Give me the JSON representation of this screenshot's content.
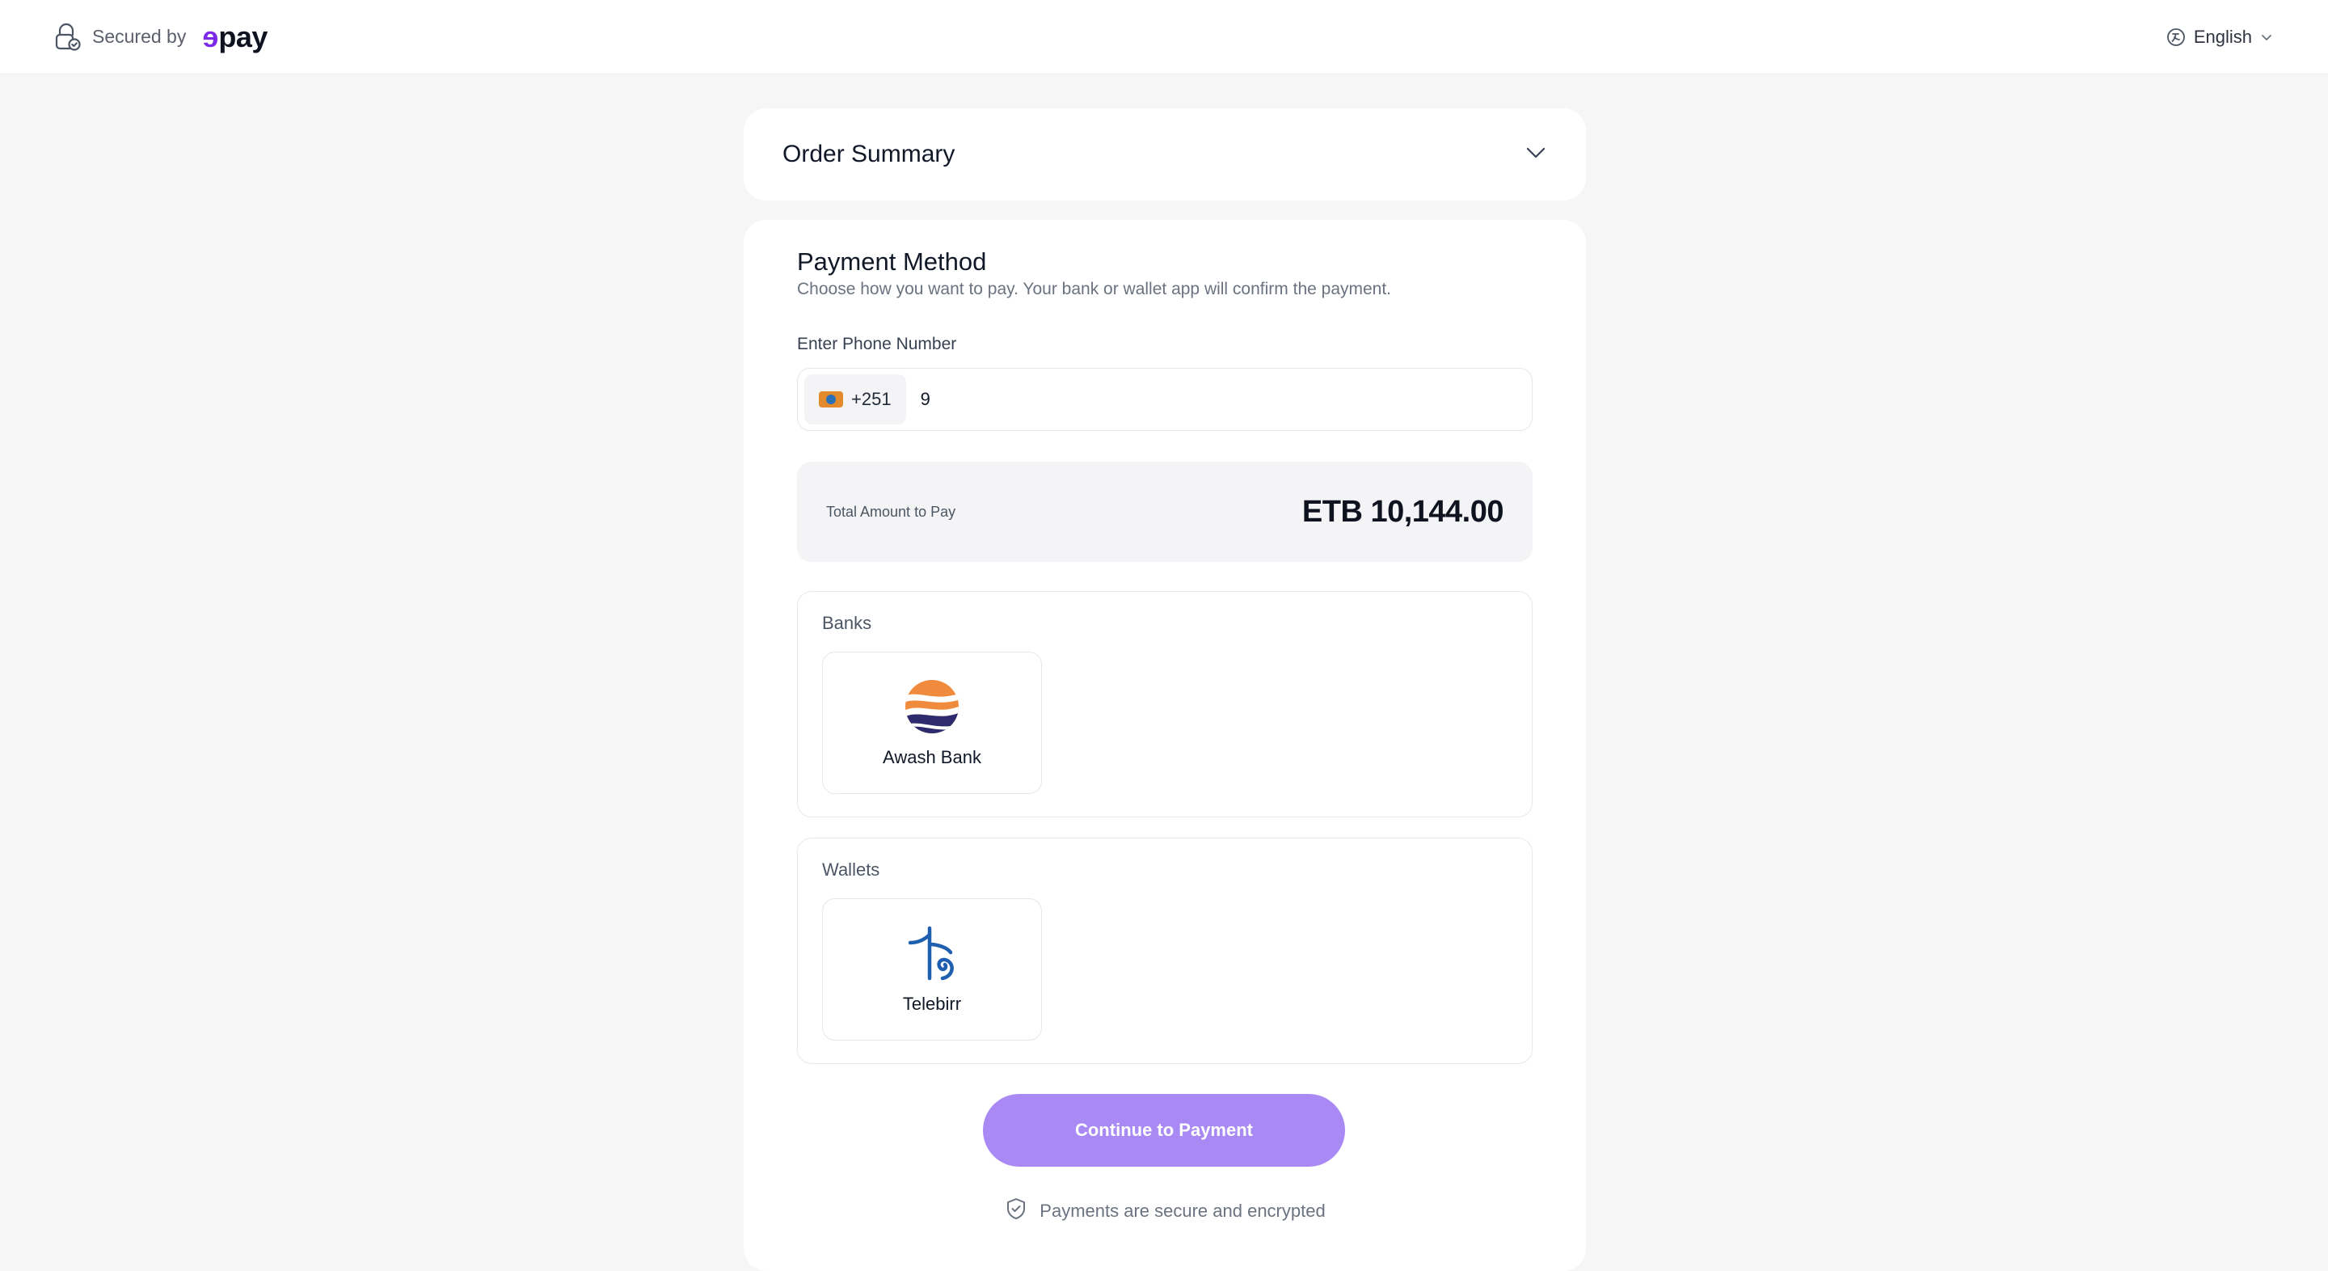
{
  "header": {
    "secured_text": "Secured by",
    "brand_e": "ɘ",
    "brand_rest": "pay",
    "language": "English",
    "brand_color": "#7c2ae8"
  },
  "order_summary": {
    "title": "Order Summary"
  },
  "payment_method": {
    "title": "Payment Method",
    "subtitle": "Choose how you want to pay. Your bank or wallet app will confirm the payment.",
    "phone_label": "Enter Phone Number",
    "country_code": "+251",
    "phone_value": "9",
    "total_label": "Total Amount to Pay",
    "total_amount": "ETB 10,144.00"
  },
  "banks": {
    "label": "Banks",
    "items": [
      {
        "name": "Awash Bank",
        "icon": "awash-bank-logo"
      }
    ]
  },
  "wallets": {
    "label": "Wallets",
    "items": [
      {
        "name": "Telebirr",
        "icon": "telebirr-logo"
      }
    ]
  },
  "actions": {
    "continue_label": "Continue to Payment",
    "continue_color": "#a98af5",
    "secure_note": "Payments are secure and encrypted"
  }
}
